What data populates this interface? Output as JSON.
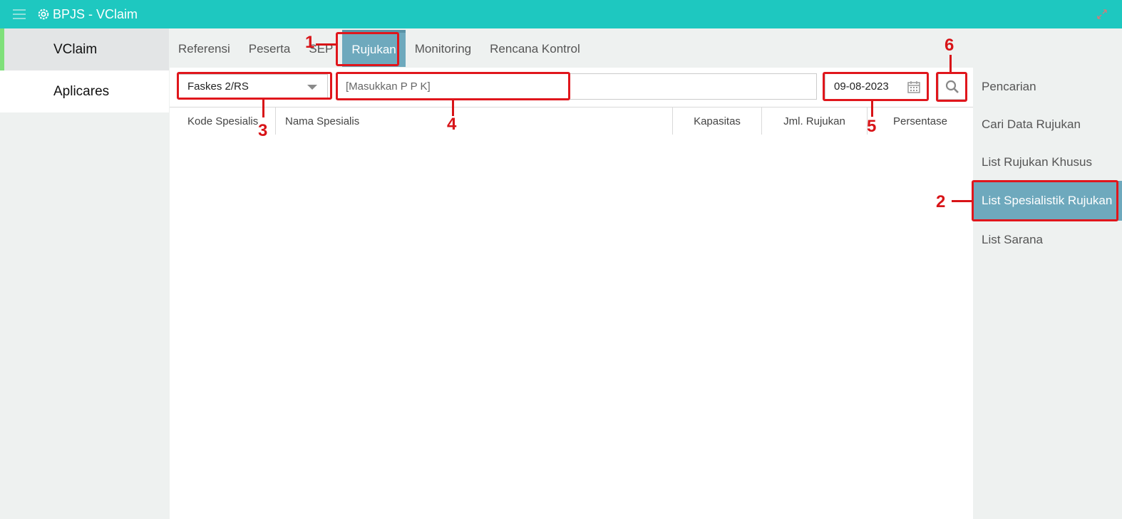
{
  "header": {
    "title": "BPJS - VClaim",
    "menu_icon": "hamburger-icon",
    "logo_icon": "gear-icon",
    "expand_icon": "expand-icon"
  },
  "left_nav": {
    "items": [
      {
        "label": "VClaim",
        "active": true
      },
      {
        "label": "Aplicares",
        "active": false
      }
    ]
  },
  "tabs": [
    {
      "label": "Referensi"
    },
    {
      "label": "Peserta"
    },
    {
      "label": "SEP"
    },
    {
      "label": "Rujukan",
      "active": true
    },
    {
      "label": "Monitoring"
    },
    {
      "label": "Rencana Kontrol"
    }
  ],
  "filters": {
    "faskes_select": "Faskes 2/RS",
    "ppk_placeholder": "[Masukkan P P K]",
    "date": "09-08-2023"
  },
  "table": {
    "headers": [
      "Kode Spesialis",
      "Nama Spesialis",
      "Kapasitas",
      "Jml. Rujukan",
      "Persentase"
    ]
  },
  "right_nav": {
    "items": [
      {
        "label": "Pencarian"
      },
      {
        "label": "Cari Data Rujukan"
      },
      {
        "label": "List Rujukan Khusus"
      },
      {
        "label": "List Spesialistik Rujukan",
        "active": true
      },
      {
        "label": "List Sarana"
      }
    ]
  },
  "annotations": [
    "1",
    "2",
    "3",
    "4",
    "5",
    "6"
  ],
  "colors": {
    "topbar": "#1ec8c0",
    "active_tab": "#6ea9bd",
    "annotation": "#e0161c"
  }
}
